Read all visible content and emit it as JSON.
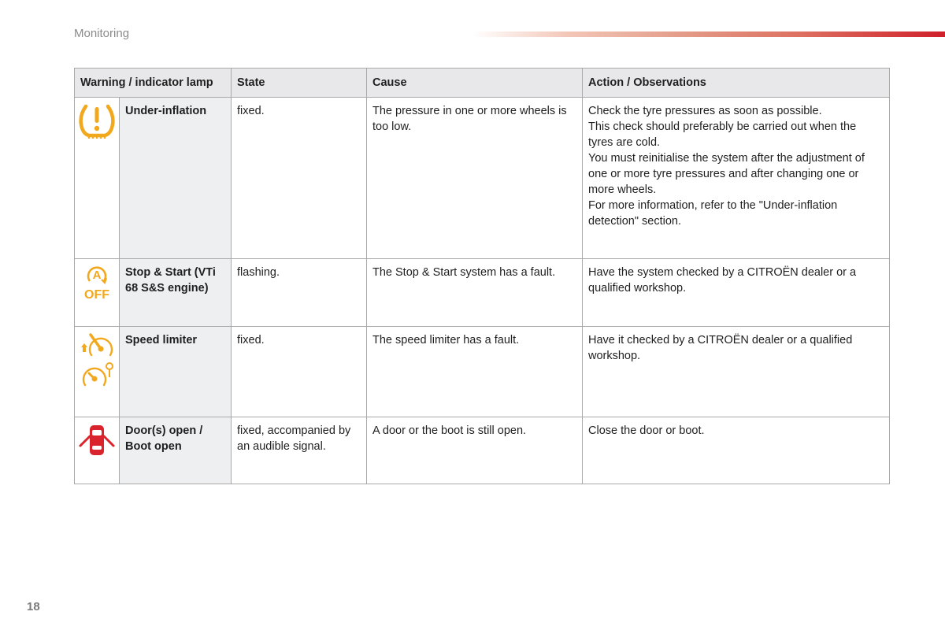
{
  "page": {
    "section_title": "Monitoring",
    "page_number": "18",
    "colors": {
      "amber": "#f2a81d",
      "red": "#d9232d",
      "header_bg": "#e8e8ea"
    }
  },
  "table": {
    "headers": {
      "lamp": "Warning / indicator lamp",
      "state": "State",
      "cause": "Cause",
      "action": "Action / Observations"
    },
    "rows": [
      {
        "icons": [
          "tyre-pressure-warning-icon"
        ],
        "name": "Under-inflation",
        "state": "fixed.",
        "cause": "The pressure in one or more wheels is too low.",
        "action": [
          "Check the tyre pressures as soon as possible.",
          "This check should preferably be carried out when the tyres are cold.",
          "You must reinitialise the system after the adjustment of one or more tyre pressures and after changing one or more wheels.",
          "For more information, refer to the \"Under-inflation detection\" section."
        ]
      },
      {
        "icons": [
          "stop-start-off-icon"
        ],
        "name": "Stop & Start (VTi 68 S&S engine)",
        "state": "flashing.",
        "cause": "The Stop & Start system has a fault.",
        "action": [
          "Have the system checked by a CITROËN dealer or a qualified workshop."
        ]
      },
      {
        "icons": [
          "speed-limiter-fault-icon",
          "speed-limiter-icon"
        ],
        "name": "Speed limiter",
        "state": "fixed.",
        "cause": "The speed limiter has a fault.",
        "action": [
          "Have it checked by a CITROËN dealer or a qualified workshop."
        ]
      },
      {
        "icons": [
          "door-open-icon"
        ],
        "name": "Door(s) open / Boot open",
        "state": "fixed, accompanied by an audible signal.",
        "cause": "A door or the boot is still open.",
        "action": [
          "Close the door or boot."
        ]
      }
    ]
  }
}
